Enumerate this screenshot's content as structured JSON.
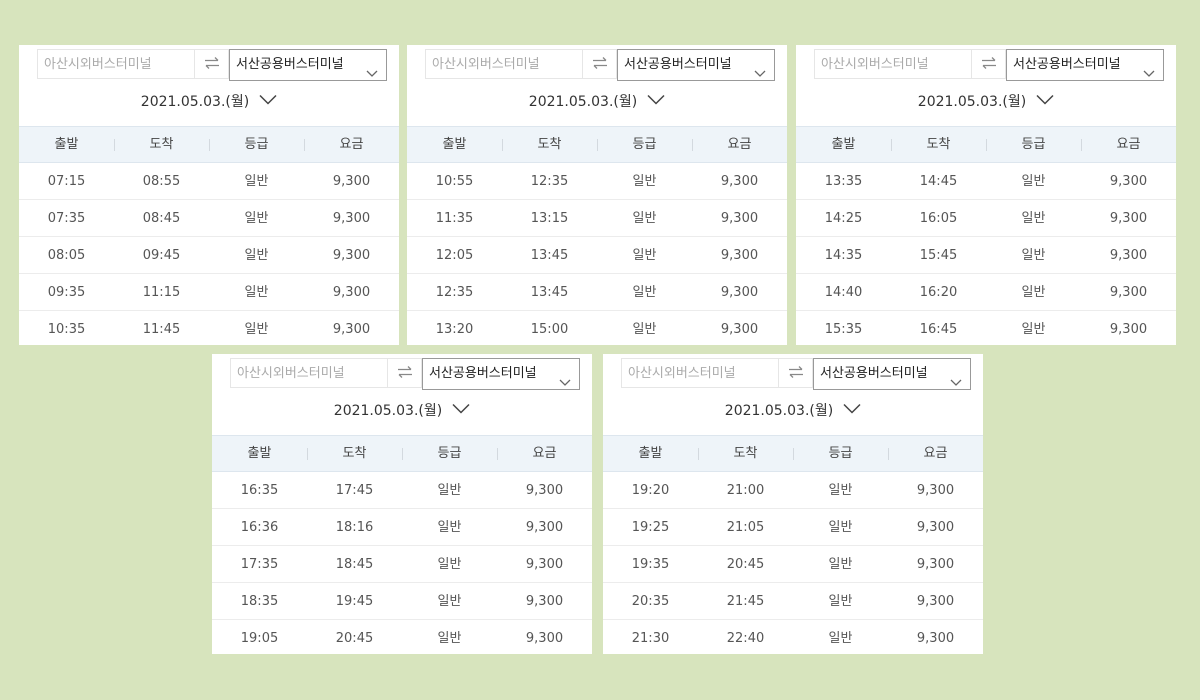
{
  "route": {
    "from_placeholder": "아산시외버스터미널",
    "to_value": "서산공용버스터미널",
    "date": "2021.05.03.(월)"
  },
  "columns": [
    "출발",
    "도착",
    "등급",
    "요금"
  ],
  "panels": [
    {
      "rows": [
        [
          "07:15",
          "08:55",
          "일반",
          "9,300"
        ],
        [
          "07:35",
          "08:45",
          "일반",
          "9,300"
        ],
        [
          "08:05",
          "09:45",
          "일반",
          "9,300"
        ],
        [
          "09:35",
          "11:15",
          "일반",
          "9,300"
        ],
        [
          "10:35",
          "11:45",
          "일반",
          "9,300"
        ]
      ]
    },
    {
      "rows": [
        [
          "10:55",
          "12:35",
          "일반",
          "9,300"
        ],
        [
          "11:35",
          "13:15",
          "일반",
          "9,300"
        ],
        [
          "12:05",
          "13:45",
          "일반",
          "9,300"
        ],
        [
          "12:35",
          "13:45",
          "일반",
          "9,300"
        ],
        [
          "13:20",
          "15:00",
          "일반",
          "9,300"
        ]
      ]
    },
    {
      "rows": [
        [
          "13:35",
          "14:45",
          "일반",
          "9,300"
        ],
        [
          "14:25",
          "16:05",
          "일반",
          "9,300"
        ],
        [
          "14:35",
          "15:45",
          "일반",
          "9,300"
        ],
        [
          "14:40",
          "16:20",
          "일반",
          "9,300"
        ],
        [
          "15:35",
          "16:45",
          "일반",
          "9,300"
        ]
      ]
    },
    {
      "rows": [
        [
          "16:35",
          "17:45",
          "일반",
          "9,300"
        ],
        [
          "16:36",
          "18:16",
          "일반",
          "9,300"
        ],
        [
          "17:35",
          "18:45",
          "일반",
          "9,300"
        ],
        [
          "18:35",
          "19:45",
          "일반",
          "9,300"
        ],
        [
          "19:05",
          "20:45",
          "일반",
          "9,300"
        ]
      ]
    },
    {
      "rows": [
        [
          "19:20",
          "21:00",
          "일반",
          "9,300"
        ],
        [
          "19:25",
          "21:05",
          "일반",
          "9,300"
        ],
        [
          "19:35",
          "20:45",
          "일반",
          "9,300"
        ],
        [
          "20:35",
          "21:45",
          "일반",
          "9,300"
        ],
        [
          "21:30",
          "22:40",
          "일반",
          "9,300"
        ]
      ]
    }
  ],
  "icons": {
    "swap": "swap-arrows-icon",
    "dropdown": "chevron-down-icon"
  },
  "colors": {
    "background": "#d7e4bd",
    "header_bg": "#eef4f9"
  }
}
